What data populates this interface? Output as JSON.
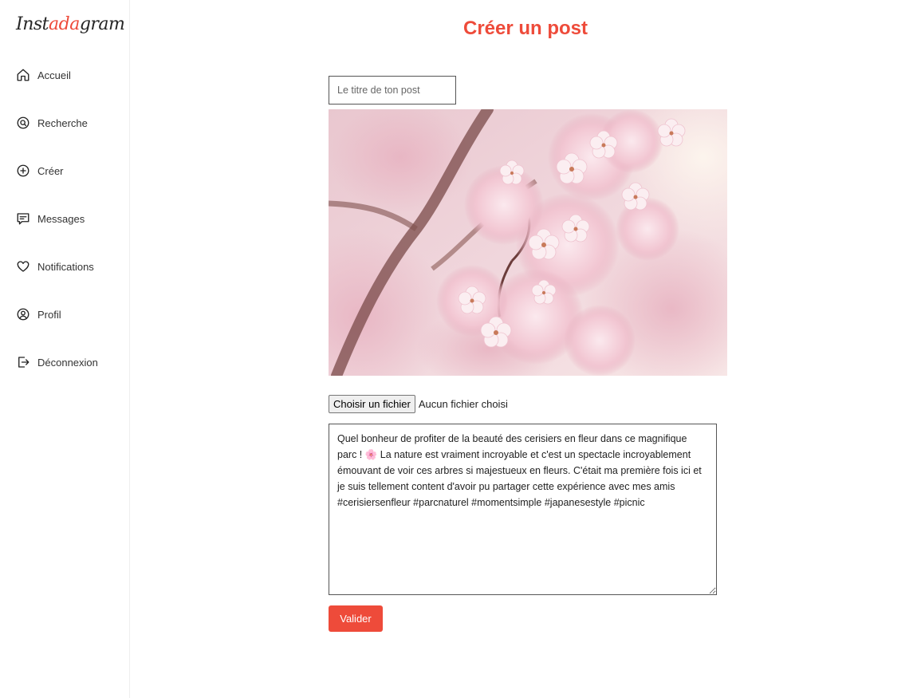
{
  "app": {
    "logo_prefix": "Inst",
    "logo_accent": "ada",
    "logo_suffix": "gram",
    "accent_color": "#ee4b3a"
  },
  "sidebar": {
    "items": [
      {
        "label": "Accueil",
        "icon": "home-icon"
      },
      {
        "label": "Recherche",
        "icon": "search-icon"
      },
      {
        "label": "Créer",
        "icon": "plus-circle-icon"
      },
      {
        "label": "Messages",
        "icon": "message-icon"
      },
      {
        "label": "Notifications",
        "icon": "heart-icon"
      },
      {
        "label": "Profil",
        "icon": "user-circle-icon"
      },
      {
        "label": "Déconnexion",
        "icon": "logout-icon"
      }
    ]
  },
  "main": {
    "title": "Créer un post",
    "title_input": {
      "value": "",
      "placeholder": "Le titre de ton post"
    },
    "image": {
      "subject": "cherry-blossom-photo"
    },
    "file_picker": {
      "button_label": "Choisir un fichier",
      "status": "Aucun fichier choisi"
    },
    "description": "Quel bonheur de profiter de la beauté des cerisiers en fleur dans ce magnifique parc ! 🌸 La nature est vraiment incroyable et c'est un spectacle incroyablement émouvant de voir ces arbres si majestueux en fleurs. C'était ma première fois ici et je suis tellement content d'avoir pu partager cette expérience avec mes amis #cerisiersenfleur #parcnaturel #momentsimple #japanesestyle #picnic",
    "submit_label": "Valider"
  }
}
